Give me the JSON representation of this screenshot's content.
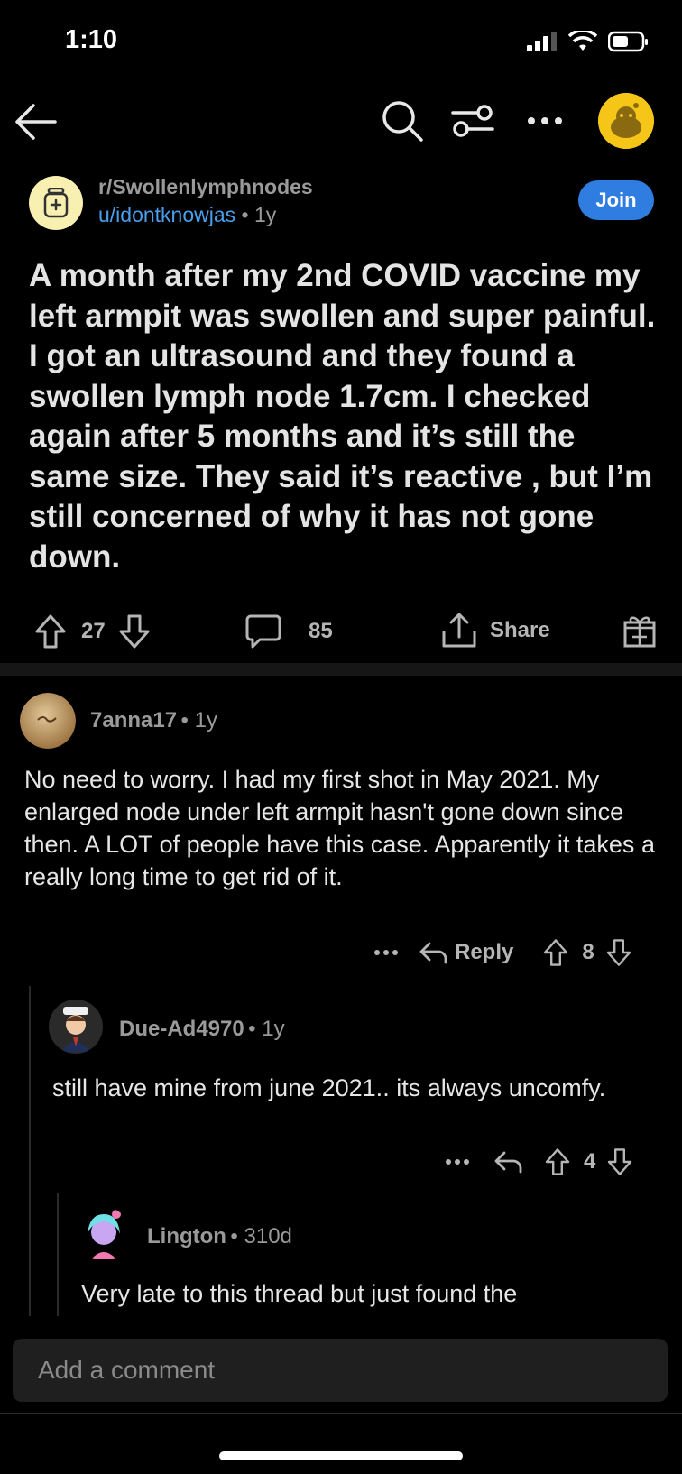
{
  "status_bar": {
    "time": "1:10"
  },
  "colors": {
    "accent": "#2f7de1",
    "username": "#4a9eea",
    "background": "#000000",
    "icon_bg": "#f5c518"
  },
  "post": {
    "subreddit": "r/Swollenlymphnodes",
    "author": "u/idontknowjas",
    "time": "1y",
    "join_label": "Join",
    "title": "A month after my 2nd COVID vaccine my left armpit was swollen and super painful. I got an ultrasound and they found a swollen lymph node 1.7cm. I checked again after 5 months and it’s still the same size. They said it’s reactive , but I’m still concerned of why it has not gone down.",
    "upvotes": "27",
    "comments": "85",
    "share_label": "Share"
  },
  "comments": [
    {
      "user": "7anna17",
      "time": "1y",
      "body": "No need to worry. I had my first shot in May 2021. My enlarged node under left armpit hasn't gone down since then. A LOT of people have this case. Apparently it takes a really long time to get rid of it.",
      "reply_label": "Reply",
      "votes": "8"
    },
    {
      "user": "Due-Ad4970",
      "time": "1y",
      "body": "still have mine from june 2021.. its always uncomfy.",
      "votes": "4"
    },
    {
      "user": "Lington",
      "time": "310d",
      "body": "Very late to this thread but just found the"
    }
  ],
  "composer": {
    "placeholder": "Add a comment"
  },
  "icons": [
    "back-arrow-icon",
    "search-icon",
    "filter-icon",
    "more-icon",
    "upvote-icon",
    "downvote-icon",
    "comment-icon",
    "share-icon",
    "award-icon",
    "reply-icon"
  ]
}
